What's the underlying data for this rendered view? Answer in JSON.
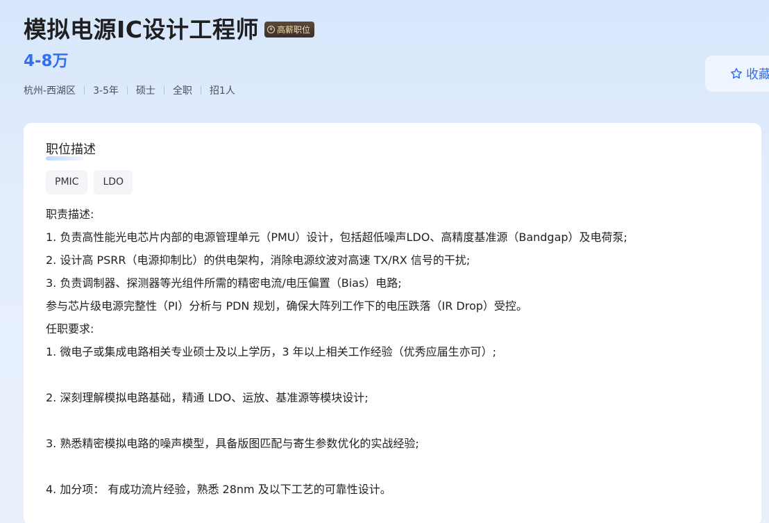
{
  "job": {
    "title": "模拟电源IC设计工程师",
    "badge": "高薪职位",
    "salary": "4-8万",
    "meta": [
      "杭州-西湖区",
      "3-5年",
      "硕士",
      "全职",
      "招1人"
    ]
  },
  "actions": {
    "collect_label": "收藏"
  },
  "description": {
    "section_title": "职位描述",
    "tags": [
      "PMIC",
      "LDO"
    ],
    "lines": [
      "职责描述:",
      "1. 负责高性能光电芯片内部的电源管理单元（PMU）设计，包括超低噪声LDO、高精度基准源（Bandgap）及电荷泵;",
      "2. 设计高 PSRR（电源抑制比）的供电架构，消除电源纹波对高速 TX/RX 信号的干扰;",
      "3. 负责调制器、探测器等光组件所需的精密电流/电压偏置（Bias）电路;",
      "参与芯片级电源完整性（PI）分析与 PDN 规划，确保大阵列工作下的电压跌落（IR Drop）受控。",
      "任职要求:",
      "1. 微电子或集成电路相关专业硕士及以上学历，3 年以上相关工作经验（优秀应届生亦可）;",
      "",
      "2. 深刻理解模拟电路基础，精通 LDO、运放、基准源等模块设计;",
      "",
      "3. 熟悉精密模拟电路的噪声模型，具备版图匹配与寄生参数优化的实战经验;",
      "",
      "4. 加分项： 有成功流片经验，熟悉 28nm 及以下工艺的可靠性设计。"
    ]
  },
  "colors": {
    "accent": "#2f6ff0",
    "badge_bg": "#3c3028",
    "badge_text": "#f6dfb2"
  }
}
